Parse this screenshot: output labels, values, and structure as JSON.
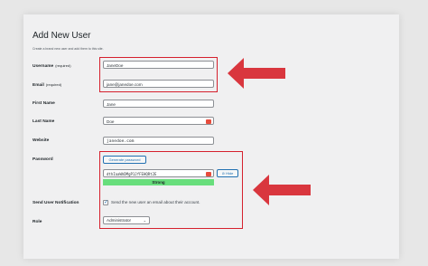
{
  "page": {
    "title": "Add New User",
    "subtitle": "Create a brand new user and add them to this site."
  },
  "form": {
    "username": {
      "label": "Username",
      "required": "(required)",
      "value": "JaneDoe"
    },
    "email": {
      "label": "Email",
      "required": "(required)",
      "value": "jane@janedoe.com"
    },
    "first_name": {
      "label": "First Name",
      "value": "Jane"
    },
    "last_name": {
      "label": "Last Name",
      "value": "Doe"
    },
    "website": {
      "label": "Website",
      "value": "janedoe.com"
    },
    "password": {
      "label": "Password",
      "generate_label": "Generate password",
      "value": "dthIaaWhDMgP1JfFEHQRt2E",
      "hide_label": "Hide",
      "strength": "Strong"
    },
    "notification": {
      "label": "Send User Notification",
      "text": "Send the new user an email about their account.",
      "checked": true
    },
    "role": {
      "label": "Role",
      "value": "Administrator"
    }
  },
  "colors": {
    "highlight": "#d5202d",
    "arrow": "#d9363e",
    "strength_bar": "#68de7c",
    "accent": "#2271b1"
  },
  "icons": [
    "password-manager-icon",
    "eye-slash-icon",
    "checkmark-icon",
    "chevron-down-icon",
    "arrow-left-icon"
  ]
}
